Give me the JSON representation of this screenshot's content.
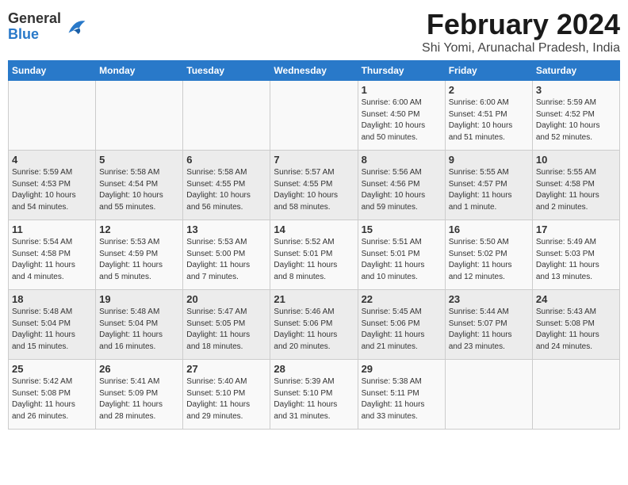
{
  "logo": {
    "line1": "General",
    "line2": "Blue"
  },
  "title": "February 2024",
  "subtitle": "Shi Yomi, Arunachal Pradesh, India",
  "days_of_week": [
    "Sunday",
    "Monday",
    "Tuesday",
    "Wednesday",
    "Thursday",
    "Friday",
    "Saturday"
  ],
  "weeks": [
    [
      {
        "day": "",
        "info": ""
      },
      {
        "day": "",
        "info": ""
      },
      {
        "day": "",
        "info": ""
      },
      {
        "day": "",
        "info": ""
      },
      {
        "day": "1",
        "info": "Sunrise: 6:00 AM\nSunset: 4:50 PM\nDaylight: 10 hours\nand 50 minutes."
      },
      {
        "day": "2",
        "info": "Sunrise: 6:00 AM\nSunset: 4:51 PM\nDaylight: 10 hours\nand 51 minutes."
      },
      {
        "day": "3",
        "info": "Sunrise: 5:59 AM\nSunset: 4:52 PM\nDaylight: 10 hours\nand 52 minutes."
      }
    ],
    [
      {
        "day": "4",
        "info": "Sunrise: 5:59 AM\nSunset: 4:53 PM\nDaylight: 10 hours\nand 54 minutes."
      },
      {
        "day": "5",
        "info": "Sunrise: 5:58 AM\nSunset: 4:54 PM\nDaylight: 10 hours\nand 55 minutes."
      },
      {
        "day": "6",
        "info": "Sunrise: 5:58 AM\nSunset: 4:55 PM\nDaylight: 10 hours\nand 56 minutes."
      },
      {
        "day": "7",
        "info": "Sunrise: 5:57 AM\nSunset: 4:55 PM\nDaylight: 10 hours\nand 58 minutes."
      },
      {
        "day": "8",
        "info": "Sunrise: 5:56 AM\nSunset: 4:56 PM\nDaylight: 10 hours\nand 59 minutes."
      },
      {
        "day": "9",
        "info": "Sunrise: 5:55 AM\nSunset: 4:57 PM\nDaylight: 11 hours\nand 1 minute."
      },
      {
        "day": "10",
        "info": "Sunrise: 5:55 AM\nSunset: 4:58 PM\nDaylight: 11 hours\nand 2 minutes."
      }
    ],
    [
      {
        "day": "11",
        "info": "Sunrise: 5:54 AM\nSunset: 4:58 PM\nDaylight: 11 hours\nand 4 minutes."
      },
      {
        "day": "12",
        "info": "Sunrise: 5:53 AM\nSunset: 4:59 PM\nDaylight: 11 hours\nand 5 minutes."
      },
      {
        "day": "13",
        "info": "Sunrise: 5:53 AM\nSunset: 5:00 PM\nDaylight: 11 hours\nand 7 minutes."
      },
      {
        "day": "14",
        "info": "Sunrise: 5:52 AM\nSunset: 5:01 PM\nDaylight: 11 hours\nand 8 minutes."
      },
      {
        "day": "15",
        "info": "Sunrise: 5:51 AM\nSunset: 5:01 PM\nDaylight: 11 hours\nand 10 minutes."
      },
      {
        "day": "16",
        "info": "Sunrise: 5:50 AM\nSunset: 5:02 PM\nDaylight: 11 hours\nand 12 minutes."
      },
      {
        "day": "17",
        "info": "Sunrise: 5:49 AM\nSunset: 5:03 PM\nDaylight: 11 hours\nand 13 minutes."
      }
    ],
    [
      {
        "day": "18",
        "info": "Sunrise: 5:48 AM\nSunset: 5:04 PM\nDaylight: 11 hours\nand 15 minutes."
      },
      {
        "day": "19",
        "info": "Sunrise: 5:48 AM\nSunset: 5:04 PM\nDaylight: 11 hours\nand 16 minutes."
      },
      {
        "day": "20",
        "info": "Sunrise: 5:47 AM\nSunset: 5:05 PM\nDaylight: 11 hours\nand 18 minutes."
      },
      {
        "day": "21",
        "info": "Sunrise: 5:46 AM\nSunset: 5:06 PM\nDaylight: 11 hours\nand 20 minutes."
      },
      {
        "day": "22",
        "info": "Sunrise: 5:45 AM\nSunset: 5:06 PM\nDaylight: 11 hours\nand 21 minutes."
      },
      {
        "day": "23",
        "info": "Sunrise: 5:44 AM\nSunset: 5:07 PM\nDaylight: 11 hours\nand 23 minutes."
      },
      {
        "day": "24",
        "info": "Sunrise: 5:43 AM\nSunset: 5:08 PM\nDaylight: 11 hours\nand 24 minutes."
      }
    ],
    [
      {
        "day": "25",
        "info": "Sunrise: 5:42 AM\nSunset: 5:08 PM\nDaylight: 11 hours\nand 26 minutes."
      },
      {
        "day": "26",
        "info": "Sunrise: 5:41 AM\nSunset: 5:09 PM\nDaylight: 11 hours\nand 28 minutes."
      },
      {
        "day": "27",
        "info": "Sunrise: 5:40 AM\nSunset: 5:10 PM\nDaylight: 11 hours\nand 29 minutes."
      },
      {
        "day": "28",
        "info": "Sunrise: 5:39 AM\nSunset: 5:10 PM\nDaylight: 11 hours\nand 31 minutes."
      },
      {
        "day": "29",
        "info": "Sunrise: 5:38 AM\nSunset: 5:11 PM\nDaylight: 11 hours\nand 33 minutes."
      },
      {
        "day": "",
        "info": ""
      },
      {
        "day": "",
        "info": ""
      }
    ]
  ]
}
